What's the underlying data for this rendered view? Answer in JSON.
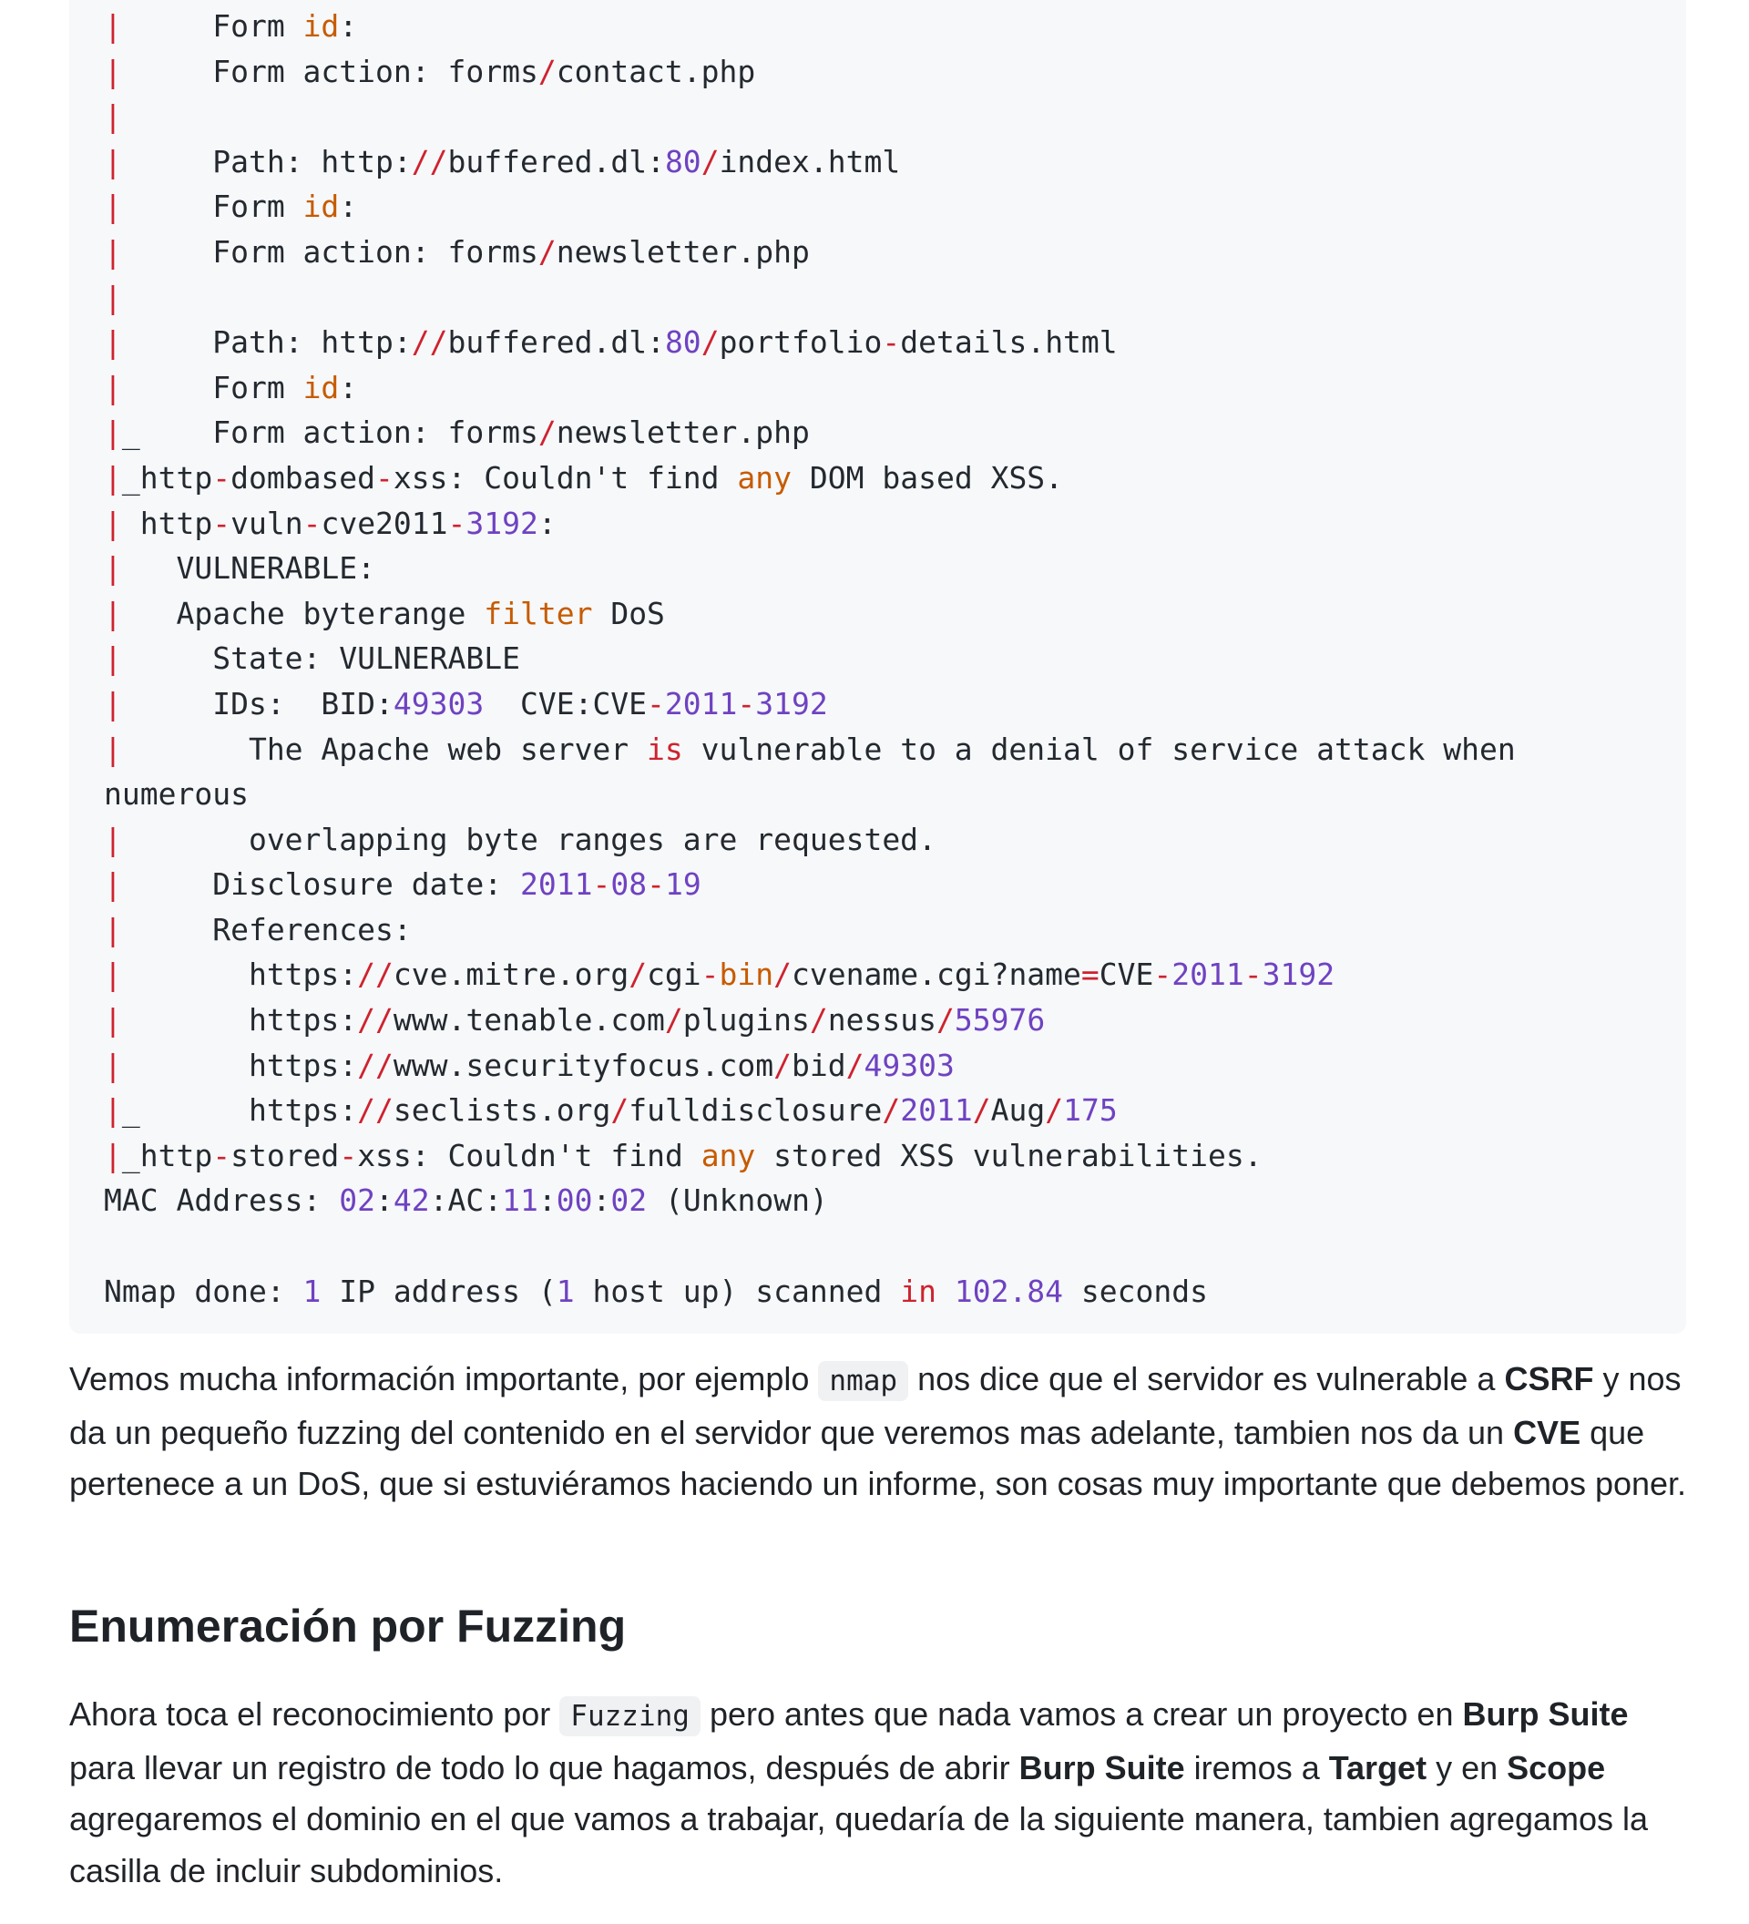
{
  "code_lines": [
    [
      [
        "p",
        "|"
      ],
      [
        "t",
        "     Form "
      ],
      [
        "a",
        "id"
      ],
      [
        "t",
        ":"
      ]
    ],
    [
      [
        "p",
        "|"
      ],
      [
        "t",
        "     Form action: forms"
      ],
      [
        "p",
        "/"
      ],
      [
        "t",
        "contact.php"
      ]
    ],
    [
      [
        "p",
        "|"
      ]
    ],
    [
      [
        "p",
        "|"
      ],
      [
        "t",
        "     Path: http:"
      ],
      [
        "p",
        "//"
      ],
      [
        "t",
        "buffered.dl:"
      ],
      [
        "n",
        "80"
      ],
      [
        "p",
        "/"
      ],
      [
        "t",
        "index.html"
      ]
    ],
    [
      [
        "p",
        "|"
      ],
      [
        "t",
        "     Form "
      ],
      [
        "a",
        "id"
      ],
      [
        "t",
        ":"
      ]
    ],
    [
      [
        "p",
        "|"
      ],
      [
        "t",
        "     Form action: forms"
      ],
      [
        "p",
        "/"
      ],
      [
        "t",
        "newsletter.php"
      ]
    ],
    [
      [
        "p",
        "|"
      ]
    ],
    [
      [
        "p",
        "|"
      ],
      [
        "t",
        "     Path: http:"
      ],
      [
        "p",
        "//"
      ],
      [
        "t",
        "buffered.dl:"
      ],
      [
        "n",
        "80"
      ],
      [
        "p",
        "/"
      ],
      [
        "t",
        "portfolio"
      ],
      [
        "p",
        "-"
      ],
      [
        "t",
        "details.html"
      ]
    ],
    [
      [
        "p",
        "|"
      ],
      [
        "t",
        "     Form "
      ],
      [
        "a",
        "id"
      ],
      [
        "t",
        ":"
      ]
    ],
    [
      [
        "p",
        "|"
      ],
      [
        "t",
        "_    Form action: forms"
      ],
      [
        "p",
        "/"
      ],
      [
        "t",
        "newsletter.php"
      ]
    ],
    [
      [
        "p",
        "|"
      ],
      [
        "t",
        "_http"
      ],
      [
        "p",
        "-"
      ],
      [
        "t",
        "dombased"
      ],
      [
        "p",
        "-"
      ],
      [
        "t",
        "xss: Couldn't find "
      ],
      [
        "a",
        "any"
      ],
      [
        "t",
        " DOM based XSS."
      ]
    ],
    [
      [
        "p",
        "|"
      ],
      [
        "t",
        " http"
      ],
      [
        "p",
        "-"
      ],
      [
        "t",
        "vuln"
      ],
      [
        "p",
        "-"
      ],
      [
        "t",
        "cve2011"
      ],
      [
        "p",
        "-"
      ],
      [
        "n",
        "3192"
      ],
      [
        "t",
        ":"
      ]
    ],
    [
      [
        "p",
        "|"
      ],
      [
        "t",
        "   VULNERABLE:"
      ]
    ],
    [
      [
        "p",
        "|"
      ],
      [
        "t",
        "   Apache byterange "
      ],
      [
        "a",
        "filter"
      ],
      [
        "t",
        " DoS"
      ]
    ],
    [
      [
        "p",
        "|"
      ],
      [
        "t",
        "     State: VULNERABLE"
      ]
    ],
    [
      [
        "p",
        "|"
      ],
      [
        "t",
        "     IDs:  BID:"
      ],
      [
        "n",
        "49303"
      ],
      [
        "t",
        "  CVE:CVE"
      ],
      [
        "p",
        "-"
      ],
      [
        "n",
        "2011"
      ],
      [
        "p",
        "-"
      ],
      [
        "n",
        "3192"
      ]
    ],
    [
      [
        "p",
        "|"
      ],
      [
        "t",
        "       The Apache web server "
      ],
      [
        "k",
        "is"
      ],
      [
        "t",
        " vulnerable to a denial of service attack when"
      ]
    ],
    [
      [
        "t",
        "numerous"
      ]
    ],
    [
      [
        "p",
        "|"
      ],
      [
        "t",
        "       overlapping byte ranges are requested."
      ]
    ],
    [
      [
        "p",
        "|"
      ],
      [
        "t",
        "     Disclosure date: "
      ],
      [
        "n",
        "2011"
      ],
      [
        "p",
        "-"
      ],
      [
        "n",
        "08"
      ],
      [
        "p",
        "-"
      ],
      [
        "n",
        "19"
      ]
    ],
    [
      [
        "p",
        "|"
      ],
      [
        "t",
        "     References:"
      ]
    ],
    [
      [
        "p",
        "|"
      ],
      [
        "t",
        "       https:"
      ],
      [
        "p",
        "//"
      ],
      [
        "t",
        "cve.mitre.org"
      ],
      [
        "p",
        "/"
      ],
      [
        "t",
        "cgi"
      ],
      [
        "p",
        "-"
      ],
      [
        "a",
        "bin"
      ],
      [
        "p",
        "/"
      ],
      [
        "t",
        "cvename.cgi?name"
      ],
      [
        "p",
        "="
      ],
      [
        "t",
        "CVE"
      ],
      [
        "p",
        "-"
      ],
      [
        "n",
        "2011"
      ],
      [
        "p",
        "-"
      ],
      [
        "n",
        "3192"
      ]
    ],
    [
      [
        "p",
        "|"
      ],
      [
        "t",
        "       https:"
      ],
      [
        "p",
        "//"
      ],
      [
        "t",
        "www.tenable.com"
      ],
      [
        "p",
        "/"
      ],
      [
        "t",
        "plugins"
      ],
      [
        "p",
        "/"
      ],
      [
        "t",
        "nessus"
      ],
      [
        "p",
        "/"
      ],
      [
        "n",
        "55976"
      ]
    ],
    [
      [
        "p",
        "|"
      ],
      [
        "t",
        "       https:"
      ],
      [
        "p",
        "//"
      ],
      [
        "t",
        "www.securityfocus.com"
      ],
      [
        "p",
        "/"
      ],
      [
        "t",
        "bid"
      ],
      [
        "p",
        "/"
      ],
      [
        "n",
        "49303"
      ]
    ],
    [
      [
        "p",
        "|"
      ],
      [
        "t",
        "_      https:"
      ],
      [
        "p",
        "//"
      ],
      [
        "t",
        "seclists.org"
      ],
      [
        "p",
        "/"
      ],
      [
        "t",
        "fulldisclosure"
      ],
      [
        "p",
        "/"
      ],
      [
        "n",
        "2011"
      ],
      [
        "p",
        "/"
      ],
      [
        "t",
        "Aug"
      ],
      [
        "p",
        "/"
      ],
      [
        "n",
        "175"
      ]
    ],
    [
      [
        "p",
        "|"
      ],
      [
        "t",
        "_http"
      ],
      [
        "p",
        "-"
      ],
      [
        "t",
        "stored"
      ],
      [
        "p",
        "-"
      ],
      [
        "t",
        "xss: Couldn't find "
      ],
      [
        "a",
        "any"
      ],
      [
        "t",
        " stored XSS vulnerabilities."
      ]
    ],
    [
      [
        "t",
        "MAC Address: "
      ],
      [
        "n",
        "02"
      ],
      [
        "t",
        ":"
      ],
      [
        "n",
        "42"
      ],
      [
        "t",
        ":AC:"
      ],
      [
        "n",
        "11"
      ],
      [
        "t",
        ":"
      ],
      [
        "n",
        "00"
      ],
      [
        "t",
        ":"
      ],
      [
        "n",
        "02"
      ],
      [
        "t",
        " (Unknown)"
      ]
    ],
    [
      [
        "t",
        ""
      ]
    ],
    [
      [
        "t",
        "Nmap done: "
      ],
      [
        "n",
        "1"
      ],
      [
        "t",
        " IP address ("
      ],
      [
        "n",
        "1"
      ],
      [
        "t",
        " host up) scanned "
      ],
      [
        "k",
        "in"
      ],
      [
        "t",
        " "
      ],
      [
        "n",
        "102.84"
      ],
      [
        "t",
        " seconds"
      ]
    ]
  ],
  "para1": {
    "t1": "Vemos mucha información importante, por ejemplo ",
    "code": "nmap",
    "t2": " nos dice que el servidor es vulnerable a ",
    "b1": "CSRF",
    "t3": " y nos da un pequeño fuzzing del contenido en el servidor que veremos mas adelante, tambien nos da un ",
    "b2": "CVE",
    "t4": " que pertenece a un DoS, que si estuviéramos haciendo un informe, son cosas muy importante que debemos poner."
  },
  "heading": "Enumeración por Fuzzing",
  "para2": {
    "t1": "Ahora toca el reconocimiento por ",
    "code": "Fuzzing",
    "t2": " pero antes que nada vamos a crear un proyecto en ",
    "b1": "Burp Suite",
    "t3": " para llevar un registro de todo lo que hagamos, después de abrir ",
    "b2": "Burp Suite",
    "t4": " iremos a ",
    "b3": "Target",
    "t5": " y en ",
    "b4": "Scope",
    "t6": " agregaremos el dominio en el que vamos a trabajar, quedaría de la siguiente manera, tambien agregamos la casilla de incluir subdominios."
  }
}
